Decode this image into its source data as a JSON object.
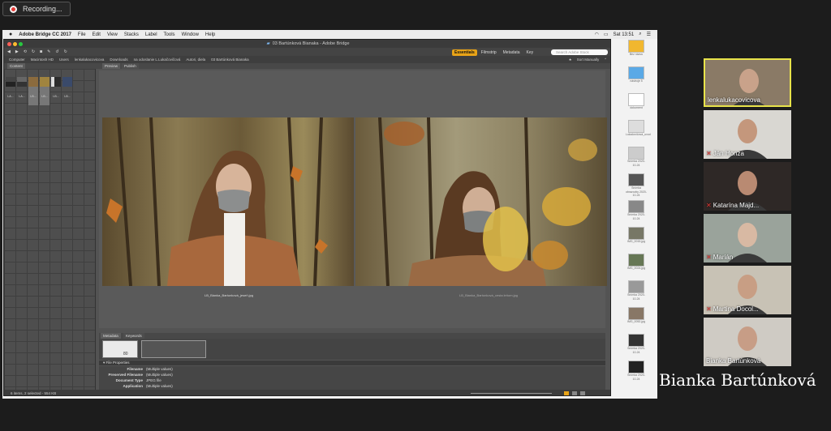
{
  "recording": {
    "label": "Recording..."
  },
  "menubar": {
    "apple": "",
    "items": [
      "Adobe Bridge CC 2017",
      "File",
      "Edit",
      "View",
      "Stacks",
      "Label",
      "Tools",
      "Window",
      "Help"
    ],
    "clock": "Sat 13:51"
  },
  "bridge": {
    "window_title": "03 Bartúnková Bianaka - Adobe Bridge",
    "workspaces": [
      "Essentials",
      "Filmstrip",
      "Metadata",
      "Key"
    ],
    "search_placeholder": "Search Adobe Stock",
    "path": [
      "Computer",
      "Macintosh HD",
      "Users",
      "lenkalukacovicova",
      "Downloads",
      "na odoslanie L.Lukačovičová",
      "Autori, diela",
      "03 Bartúnková Bianaka"
    ],
    "sort_label": "Sort Manually",
    "tabs": {
      "content": "Content",
      "preview": "Preview",
      "publish": "Publish",
      "metadata": "Metadata",
      "keywords": "Keywords"
    },
    "thumb_labels": [
      "LA...",
      "LA...",
      "LB...",
      "LB...",
      "LB...",
      "LB..."
    ],
    "preview_captions": [
      "LB_Bianka_Bartunková_jeseň.jpg",
      "LB_Bianka_Bartunková_cesta leňom.jpg"
    ],
    "file_properties_header": "File Properties",
    "metadata_value": "80",
    "file_properties": [
      {
        "key": "Filename",
        "value": "(Multiple values)"
      },
      {
        "key": "Preserved Filename",
        "value": "(Multiple values)"
      },
      {
        "key": "Document Type",
        "value": "JPEG file"
      },
      {
        "key": "Application",
        "value": "(Multiple values)"
      }
    ],
    "status": "6 items, 2 selected - 554 KB"
  },
  "desktop_icons": [
    {
      "label": "Bez názvu",
      "color": "#f1b72f"
    },
    {
      "label": "nástroje 5",
      "color": "#5aa9e6"
    },
    {
      "label": "dokument",
      "color": "#ffffff"
    },
    {
      "label": "Lukačovičová_uvod",
      "color": "#dddddd"
    },
    {
      "label": "Snímka 2020-10-24",
      "color": "#cccccc"
    },
    {
      "label": "Snímka obrazovky 2020-10-24",
      "color": "#555555"
    },
    {
      "label": "Snímka 2020-10-24",
      "color": "#888888"
    },
    {
      "label": "IMG_0015.jpg",
      "color": "#777766"
    },
    {
      "label": "IMG_0024.jpg",
      "color": "#667755"
    },
    {
      "label": "Snímka 2020-10-24",
      "color": "#999999"
    },
    {
      "label": "IMG_0052.jpg",
      "color": "#887766"
    },
    {
      "label": "Snímka 2020-10-24",
      "color": "#333333"
    },
    {
      "label": "Snímka 2020-10-24",
      "color": "#222222"
    }
  ],
  "participants": [
    {
      "name": "lenkalukacovicova",
      "muted": false,
      "active": true,
      "bg": "#8a7a66",
      "face": "#c9a28a"
    },
    {
      "name": "Ján Honza",
      "muted": true,
      "active": false,
      "bg": "#d9d7d2",
      "face": "#c4977c"
    },
    {
      "name": "Katarína Majd...",
      "muted": true,
      "active": false,
      "bg": "#2e2826",
      "face": "#b98a72"
    },
    {
      "name": "Marián",
      "muted": true,
      "active": false,
      "bg": "#9aa39b",
      "face": "#d8b9a3"
    },
    {
      "name": "Martina Docol...",
      "muted": true,
      "active": false,
      "bg": "#c8c2b5",
      "face": "#c89e84"
    },
    {
      "name": "Bianka Bartúnková",
      "muted": false,
      "active": false,
      "bg": "#cfcbc4",
      "face": "#c79d86"
    }
  ],
  "speaker": {
    "name": "Bianka Bartúnková"
  },
  "colors": {
    "accent": "#e8a317",
    "active_border": "#e8e34a",
    "muted": "#e53935"
  }
}
